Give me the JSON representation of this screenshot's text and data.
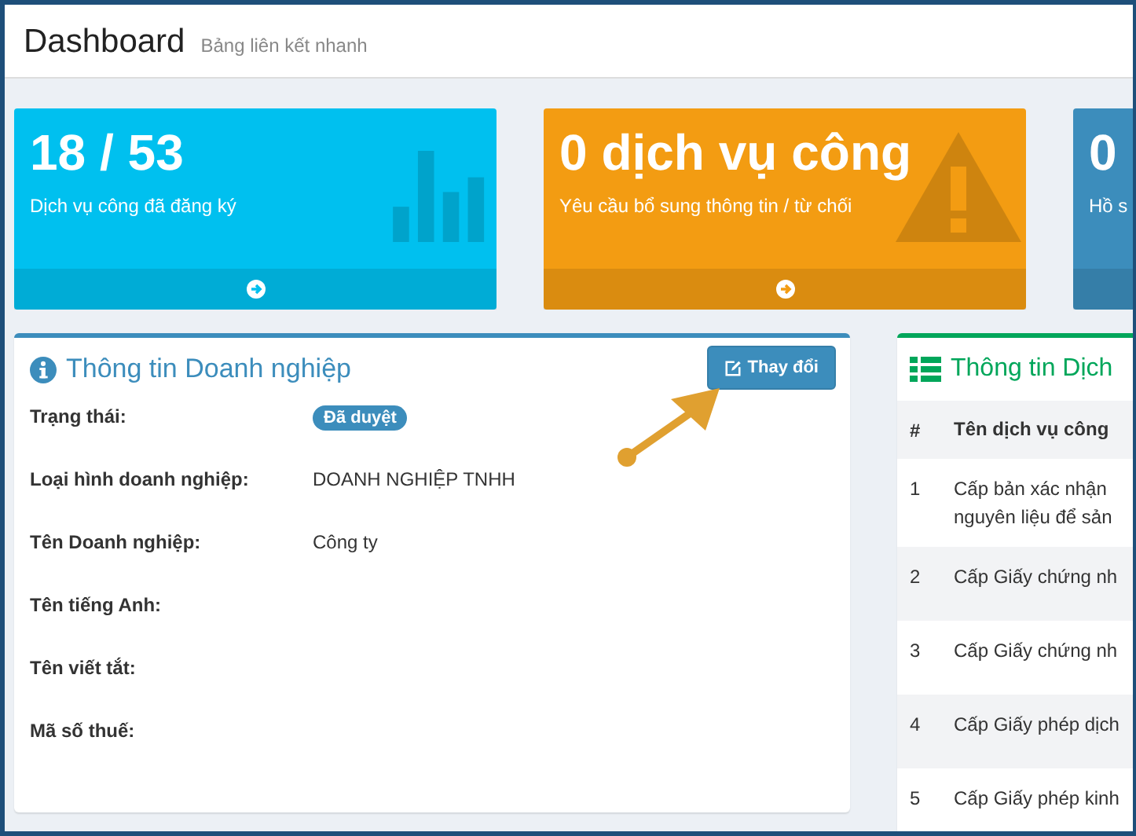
{
  "header": {
    "title": "Dashboard",
    "subtitle": "Bảng liên kết nhanh"
  },
  "tiles": [
    {
      "kind": "chart",
      "value": "18 / 53",
      "label": "Dịch vụ công đã đăng ký",
      "color": "#00c0ef"
    },
    {
      "kind": "warning",
      "value": "0 dịch vụ công",
      "label": "Yêu cầu bổ sung thông tin / từ chối",
      "color": "#f39c12"
    },
    {
      "kind": "plain",
      "value": "0",
      "label": "Hồ s",
      "color": "#3c8dbc"
    }
  ],
  "company_panel": {
    "title": "Thông tin Doanh nghiệp",
    "button": "Thay đổi",
    "fields": [
      {
        "label": "Trạng thái:",
        "value": "Đã duyệt",
        "kind": "badge"
      },
      {
        "label": "Loại hình doanh nghiệp:",
        "value": "DOANH NGHIỆP TNHH",
        "kind": "text"
      },
      {
        "label": "Tên Doanh nghiệp:",
        "value": "Công ty",
        "kind": "text"
      },
      {
        "label": "Tên tiếng Anh:"
      },
      {
        "label": "Tên viết tắt:"
      },
      {
        "label": "Mã số thuế:"
      }
    ]
  },
  "services_panel": {
    "title": "Thông tin Dịch",
    "columns": [
      "#",
      "Tên dịch vụ công"
    ],
    "rows": [
      {
        "index": "1",
        "name": "Cấp bản xác nhận\nnguyên liệu để sản"
      },
      {
        "index": "2",
        "name": "Cấp Giấy chứng nh"
      },
      {
        "index": "3",
        "name": "Cấp Giấy chứng nh"
      },
      {
        "index": "4",
        "name": "Cấp Giấy phép dịch"
      },
      {
        "index": "5",
        "name": "Cấp Giấy phép kinh"
      }
    ]
  }
}
